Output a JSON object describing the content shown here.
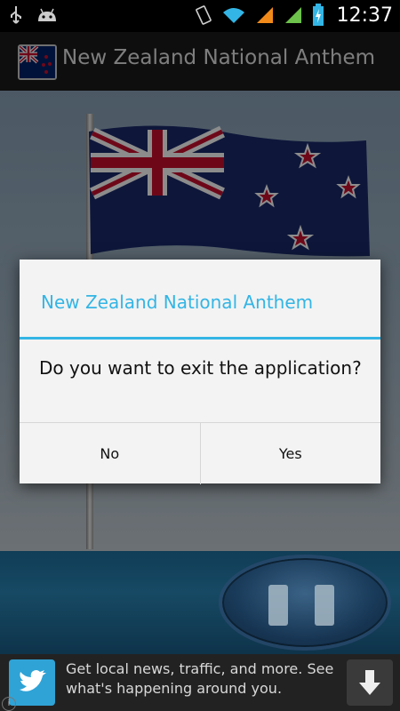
{
  "status_bar": {
    "time": "12:37",
    "icons": [
      "usb-icon",
      "android-icon",
      "vibrate-icon",
      "wifi-icon",
      "signal-icon",
      "signal-icon",
      "battery-charging-icon"
    ]
  },
  "action_bar": {
    "title": "New Zealand National Anthem",
    "icon": "nz-flag-icon"
  },
  "dialog": {
    "title": "New Zealand National Anthem",
    "message": "Do you want to exit the application?",
    "buttons": {
      "no": "No",
      "yes": "Yes"
    }
  },
  "player": {
    "control": "pause-icon"
  },
  "ad": {
    "text": "Get local news, traffic, and more. See what's happening around you.",
    "logo": "twitter-bird-icon",
    "action_icon": "download-arrow-icon",
    "info_icon": "info-icon",
    "info_glyph": "i"
  },
  "colors": {
    "accent": "#33b5e5",
    "dialog_bg": "#f3f3f3",
    "action_bar_bg": "#1a1a1a"
  }
}
